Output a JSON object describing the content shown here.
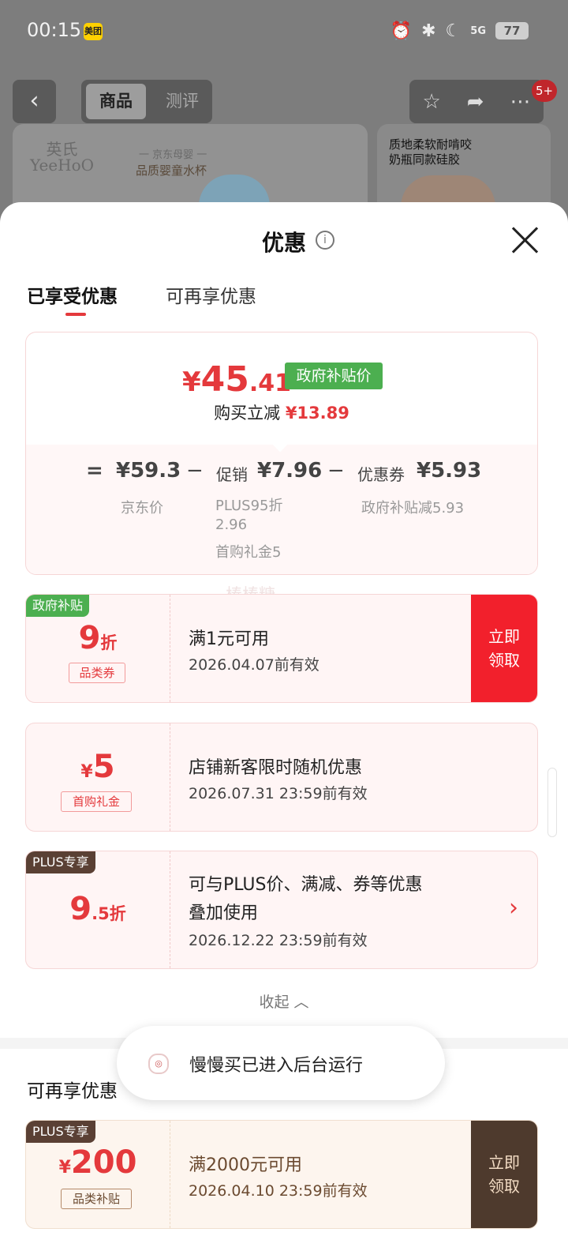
{
  "status_bar": {
    "time": "00:15",
    "app_badge": "美团",
    "battery": "77",
    "signal_label": "5G"
  },
  "top_nav": {
    "tab_active": "商品",
    "tab_inactive": "测评",
    "cart_badge": "5+"
  },
  "products": {
    "p1_brand_cn": "英氏",
    "p1_brand_en": "YeeHoO",
    "p1_tag1": "一 京东母婴 一",
    "p1_tag2": "品质婴童水杯",
    "p2_title": "质地柔软耐啃咬\n奶瓶同款硅胶"
  },
  "sheet": {
    "title": "优惠",
    "tabs": [
      "已享受优惠",
      "可再享优惠"
    ],
    "final_price": {
      "currency": "¥",
      "int": "45",
      "dec": ".41"
    },
    "price_tag": "政府补贴价",
    "save_label": "购买立减",
    "save_value": "¥13.89",
    "breakdown": {
      "eq": "=",
      "jd_price": "¥59.3",
      "minus": "−",
      "promo_label": "促销",
      "promo_value": "¥7.96",
      "coupon_label": "优惠券",
      "coupon_value": "¥5.93",
      "jd_price_label": "京东价",
      "promo_detail1": "PLUS95折 2.96",
      "promo_detail2": "首购礼金5",
      "coupon_detail": "政府补贴减5.93"
    },
    "watermark": "棒棒糖"
  },
  "coupons": [
    {
      "corner": "政府补贴",
      "amount_main": "9",
      "amount_unit": "折",
      "label": "品类券",
      "condition": "满1元可用",
      "expiry": "2026.04.07前有效",
      "button": "立即领取"
    },
    {
      "currency": "¥",
      "amount_main": "5",
      "label": "首购礼金",
      "condition": "店铺新客限时随机优惠",
      "expiry": "2026.07.31 23:59前有效"
    },
    {
      "corner": "PLUS专享",
      "amount_main": "9",
      "amount_unit": ".5折",
      "condition_line1": "可与PLUS价、满减、券等优惠",
      "condition_line2": "叠加使用",
      "expiry": "2026.12.22 23:59前有效",
      "arrow": "›"
    }
  ],
  "collapse_label": "收起",
  "section2_title": "可再享优惠",
  "coupon_plus": {
    "corner": "PLUS专享",
    "currency": "¥",
    "amount_main": "200",
    "label": "品类补贴",
    "condition": "满2000元可用",
    "expiry": "2026.04.10 23:59前有效",
    "button": "立即领取"
  },
  "toast": {
    "text": "慢慢买已进入后台运行"
  },
  "colors": {
    "accent_red": "#e4393c",
    "gov_green": "#4caf50",
    "plus_brown": "#5a4034"
  }
}
